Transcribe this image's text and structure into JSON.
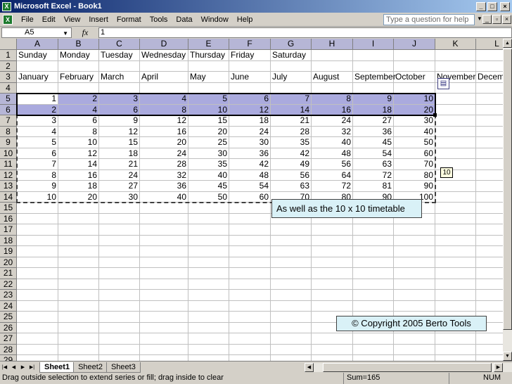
{
  "window": {
    "title": "Microsoft Excel - Book1"
  },
  "menu": [
    "File",
    "Edit",
    "View",
    "Insert",
    "Format",
    "Tools",
    "Data",
    "Window",
    "Help"
  ],
  "question_box": {
    "placeholder": "Type a question for help"
  },
  "formula": {
    "name_box": "A5",
    "fx": "fx",
    "value": "1"
  },
  "columns": [
    "A",
    "B",
    "C",
    "D",
    "E",
    "F",
    "G",
    "H",
    "I",
    "J",
    "K",
    "L"
  ],
  "rows": [
    "1",
    "2",
    "3",
    "4",
    "5",
    "6",
    "7",
    "8",
    "9",
    "10",
    "11",
    "12",
    "13",
    "14",
    "15",
    "16",
    "17",
    "18",
    "19",
    "20",
    "21",
    "22",
    "23",
    "24",
    "25",
    "26",
    "27",
    "28",
    "29"
  ],
  "days": [
    "Sunday",
    "Monday",
    "Tuesday",
    "Wednesday",
    "Thursday",
    "Friday",
    "Saturday"
  ],
  "months": [
    "January",
    "February",
    "March",
    "April",
    "May",
    "June",
    "July",
    "August",
    "September",
    "October",
    "November",
    "December"
  ],
  "table": [
    [
      "1",
      "2",
      "3",
      "4",
      "5",
      "6",
      "7",
      "8",
      "9",
      "10"
    ],
    [
      "2",
      "4",
      "6",
      "8",
      "10",
      "12",
      "14",
      "16",
      "18",
      "20"
    ],
    [
      "3",
      "6",
      "9",
      "12",
      "15",
      "18",
      "21",
      "24",
      "27",
      "30"
    ],
    [
      "4",
      "8",
      "12",
      "16",
      "20",
      "24",
      "28",
      "32",
      "36",
      "40"
    ],
    [
      "5",
      "10",
      "15",
      "20",
      "25",
      "30",
      "35",
      "40",
      "45",
      "50"
    ],
    [
      "6",
      "12",
      "18",
      "24",
      "30",
      "36",
      "42",
      "48",
      "54",
      "60"
    ],
    [
      "7",
      "14",
      "21",
      "28",
      "35",
      "42",
      "49",
      "56",
      "63",
      "70"
    ],
    [
      "8",
      "16",
      "24",
      "32",
      "40",
      "48",
      "56",
      "64",
      "72",
      "80"
    ],
    [
      "9",
      "18",
      "27",
      "36",
      "45",
      "54",
      "63",
      "72",
      "81",
      "90"
    ],
    [
      "10",
      "20",
      "30",
      "40",
      "50",
      "60",
      "70",
      "80",
      "90",
      "100"
    ]
  ],
  "fill_tooltip": "10",
  "note": "As well as the 10 x 10 timetable",
  "copyright": "© Copyright 2005 Berto Tools",
  "sheets": [
    "Sheet1",
    "Sheet2",
    "Sheet3"
  ],
  "status": {
    "message": "Drag outside selection to extend series or fill; drag inside to clear",
    "sum": "Sum=165",
    "mode": "NUM"
  }
}
